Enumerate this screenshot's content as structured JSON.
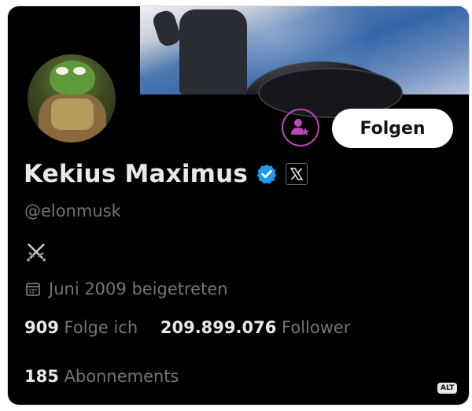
{
  "profile": {
    "display_name": "Kekius Maximus",
    "handle": "@elonmusk",
    "bio_icon": "crossed-swords-icon",
    "joined": "Juni 2009 beigetreten",
    "verified": true
  },
  "actions": {
    "follow_label": "Folgen",
    "subscribe_icon": "person-star-icon"
  },
  "stats": {
    "following_count": "909",
    "following_label": "Folge ich",
    "followers_count": "209.899.076",
    "followers_label": "Follower",
    "subscriptions_count": "185",
    "subscriptions_label": "Abonnements"
  },
  "alt_badge": "ALT",
  "colors": {
    "background": "#000000",
    "primary_text": "#e7e9ea",
    "secondary_text": "#71767b",
    "verified_blue": "#1d9bf0",
    "subscribe_accent": "#b948b4"
  }
}
